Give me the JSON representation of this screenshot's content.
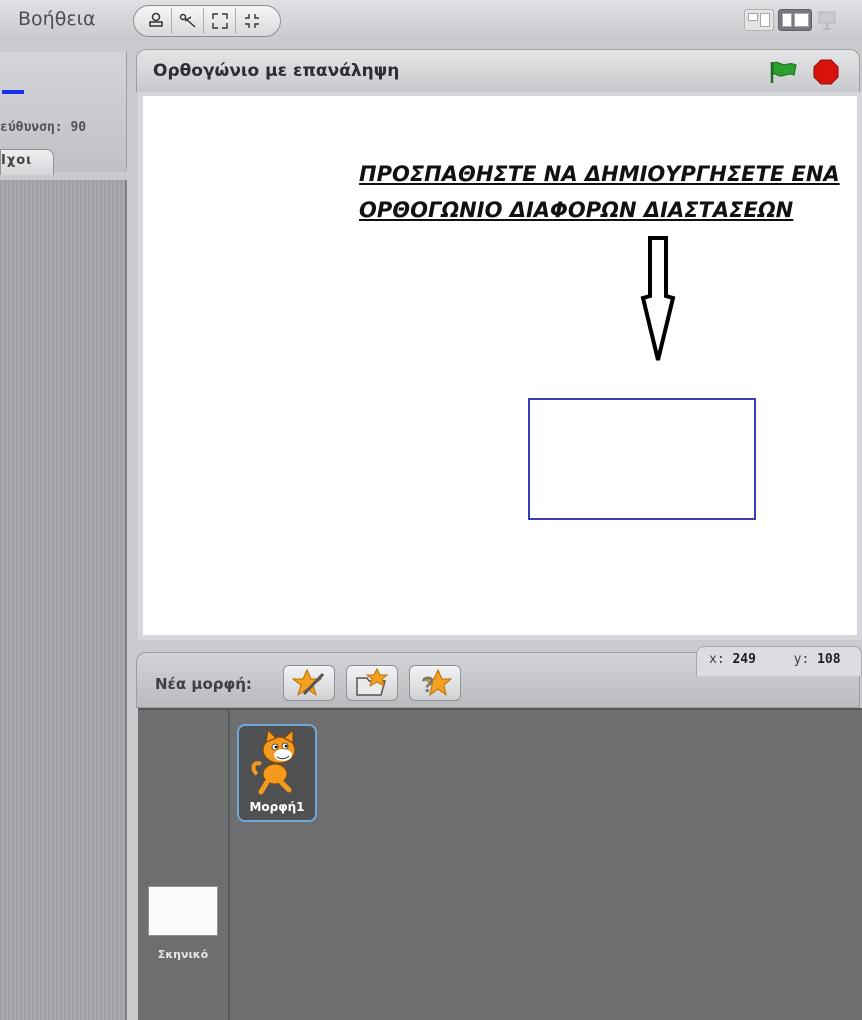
{
  "menu": {
    "help_label": "Βοήθεια"
  },
  "toolbar": {
    "tools": [
      "stamp-icon",
      "scissors-icon",
      "grow-icon",
      "shrink-icon"
    ],
    "view_modes": [
      "small-stage-icon",
      "normal-stage-icon",
      "presentation-icon"
    ]
  },
  "left_panel": {
    "direction_text": "εύθυνση: 90",
    "sounds_tab_label": "Ιχοι"
  },
  "stage": {
    "project_title": "Ορθογώνιο με επανάληψη",
    "instruction_line1": "ΠΡΟΣΠΑΘΗΣΤΕ ΝΑ ΔΗΜΙΟΥΡΓΗΣΕΤΕ ΕΝΑ",
    "instruction_line2": "ΟΡΘΟΓΩΝΙΟ ΔΙΑΦΟΡΩΝ ΔΙΑΣΤΑΣΕΩΝ",
    "colors": {
      "pen": "#3a3fb8",
      "flag": "#2ca02c",
      "stop": "#d9120c"
    }
  },
  "mouse": {
    "x_label": "x:",
    "x_value": "249",
    "y_label": "y:",
    "y_value": "108"
  },
  "sprite_bar": {
    "new_sprite_label": "Νέα μορφή:",
    "buttons": [
      "paint-new-sprite-icon",
      "choose-sprite-file-icon",
      "random-sprite-icon"
    ]
  },
  "sprites": {
    "stage_label": "Σκηνικό",
    "items": [
      {
        "name": "Μορφή1",
        "icon": "cat-sprite-icon"
      }
    ]
  }
}
